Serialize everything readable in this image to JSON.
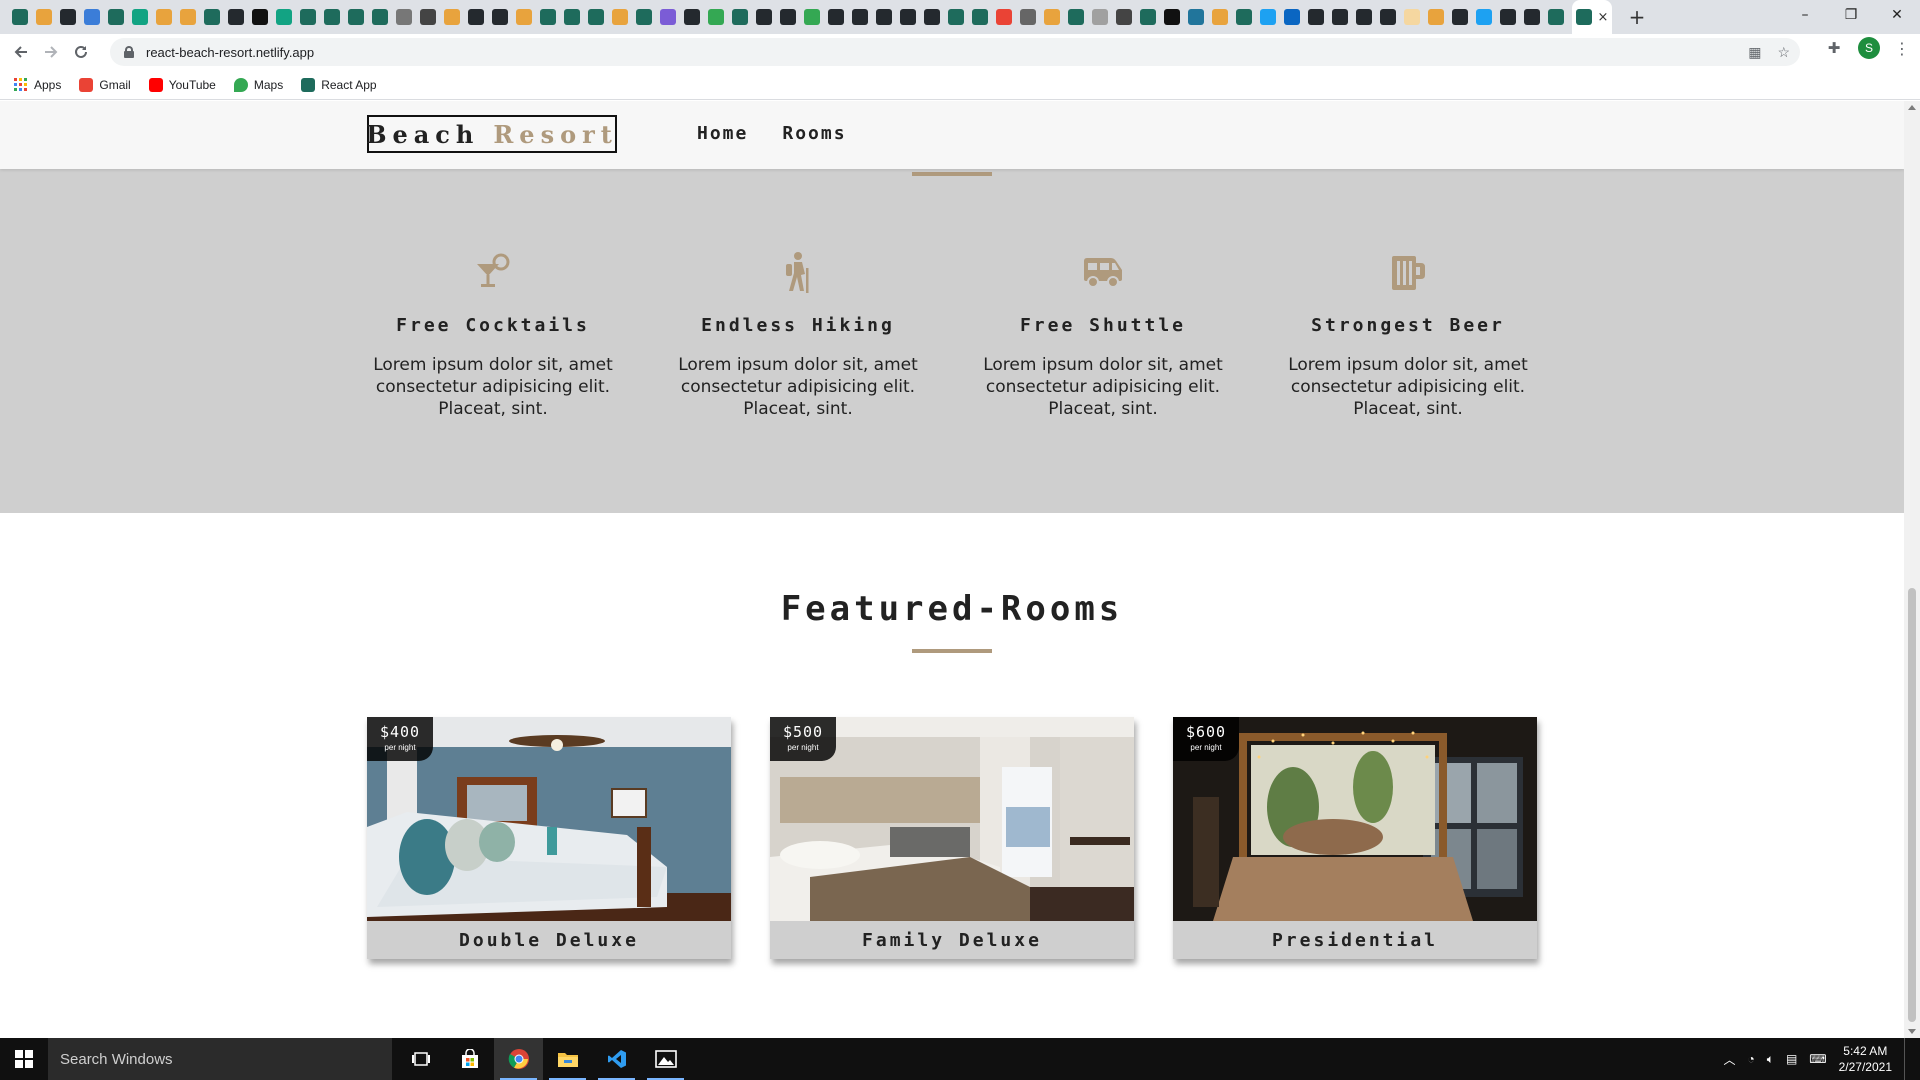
{
  "browser": {
    "tab_colors": [
      "#1e6b5c",
      "#e8a33d",
      "#24292e",
      "#3b7dd8",
      "#1e6b5c",
      "#12a383",
      "#e8a33d",
      "#e8a33d",
      "#1e6b5c",
      "#24292e",
      "#111111",
      "#12a383",
      "#1e6b5c",
      "#1e6b5c",
      "#1e6b5c",
      "#1e6b5c",
      "#777777",
      "#444444",
      "#e8a33d",
      "#24292e",
      "#24292e",
      "#e8a33d",
      "#1e6b5c",
      "#1e6b5c",
      "#1e6b5c",
      "#e8a33d",
      "#1e6b5c",
      "#7b5cd6",
      "#24292e",
      "#34a853",
      "#1e6b5c",
      "#24292e",
      "#24292e",
      "#34a853",
      "#24292e",
      "#24292e",
      "#24292e",
      "#24292e",
      "#24292e",
      "#1e6b5c",
      "#1e6b5c",
      "#ea4335",
      "#666666",
      "#e8a33d",
      "#1e6b5c",
      "#a0a0a0",
      "#444444",
      "#1e6b5c",
      "#111111",
      "#21759b",
      "#e8a33d",
      "#1e6b5c",
      "#1da1f2",
      "#0a66c2",
      "#24292e",
      "#24292e",
      "#24292e",
      "#24292e",
      "#f5d7a0",
      "#e8a33d",
      "#24292e",
      "#1da1f2",
      "#24292e",
      "#24292e",
      "#1e6b5c"
    ],
    "active_tab_close": "×",
    "new_tab": "+",
    "window_controls": {
      "minimize": "–",
      "restore": "❐",
      "close": "✕"
    },
    "url": "react-beach-resort.netlify.app",
    "profile_initial": "S",
    "bookmarks": [
      {
        "label": "Apps",
        "icon": "apps-grid-icon"
      },
      {
        "label": "Gmail",
        "icon": "gmail-icon",
        "color": "#ea4335"
      },
      {
        "label": "YouTube",
        "icon": "youtube-icon",
        "color": "#ff0000"
      },
      {
        "label": "Maps",
        "icon": "maps-pin-icon",
        "color": "#34a853"
      },
      {
        "label": "React App",
        "icon": "react-icon",
        "color": "#1e6b5c"
      }
    ]
  },
  "site": {
    "logo_word1": "Beach",
    "logo_word2": "Resort",
    "nav": [
      "Home",
      "Rooms"
    ],
    "accent": "#af9a7d",
    "services": [
      {
        "title": "Free Cocktails",
        "icon": "cocktail-icon",
        "text": "Lorem ipsum dolor sit, amet consectetur adipisicing elit. Placeat, sint."
      },
      {
        "title": "Endless Hiking",
        "icon": "hiking-icon",
        "text": "Lorem ipsum dolor sit, amet consectetur adipisicing elit. Placeat, sint."
      },
      {
        "title": "Free Shuttle",
        "icon": "shuttle-van-icon",
        "text": "Lorem ipsum dolor sit, amet consectetur adipisicing elit. Placeat, sint."
      },
      {
        "title": "Strongest Beer",
        "icon": "beer-mug-icon",
        "text": "Lorem ipsum dolor sit, amet consectetur adipisicing elit. Placeat, sint."
      }
    ],
    "featured_title": "Featured-Rooms",
    "rooms": [
      {
        "name": "Double Deluxe",
        "price": "$400",
        "per": "per night"
      },
      {
        "name": "Family Deluxe",
        "price": "$500",
        "per": "per night"
      },
      {
        "name": "Presidential",
        "price": "$600",
        "per": "per night"
      }
    ]
  },
  "taskbar": {
    "search_placeholder": "Search Windows",
    "time": "5:42 AM",
    "date": "2/27/2021"
  }
}
